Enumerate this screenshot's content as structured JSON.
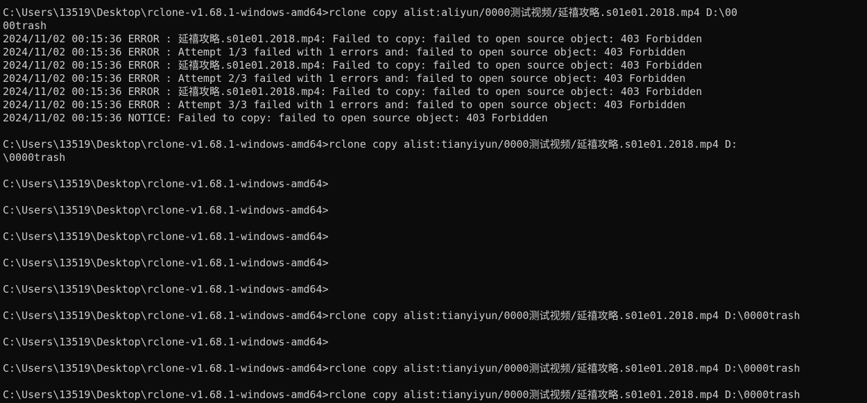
{
  "terminal": {
    "lines": [
      "C:\\Users\\13519\\Desktop\\rclone-v1.68.1-windows-amd64>rclone copy alist:aliyun/0000测试视频/延禧攻略.s01e01.2018.mp4 D:\\00",
      "00trash",
      "2024/11/02 00:15:36 ERROR : 延禧攻略.s01e01.2018.mp4: Failed to copy: failed to open source object: 403 Forbidden",
      "2024/11/02 00:15:36 ERROR : Attempt 1/3 failed with 1 errors and: failed to open source object: 403 Forbidden",
      "2024/11/02 00:15:36 ERROR : 延禧攻略.s01e01.2018.mp4: Failed to copy: failed to open source object: 403 Forbidden",
      "2024/11/02 00:15:36 ERROR : Attempt 2/3 failed with 1 errors and: failed to open source object: 403 Forbidden",
      "2024/11/02 00:15:36 ERROR : 延禧攻略.s01e01.2018.mp4: Failed to copy: failed to open source object: 403 Forbidden",
      "2024/11/02 00:15:36 ERROR : Attempt 3/3 failed with 1 errors and: failed to open source object: 403 Forbidden",
      "2024/11/02 00:15:36 NOTICE: Failed to copy: failed to open source object: 403 Forbidden",
      "",
      "C:\\Users\\13519\\Desktop\\rclone-v1.68.1-windows-amd64>rclone copy alist:tianyiyun/0000测试视频/延禧攻略.s01e01.2018.mp4 D:",
      "\\0000trash",
      "",
      "C:\\Users\\13519\\Desktop\\rclone-v1.68.1-windows-amd64>",
      "",
      "C:\\Users\\13519\\Desktop\\rclone-v1.68.1-windows-amd64>",
      "",
      "C:\\Users\\13519\\Desktop\\rclone-v1.68.1-windows-amd64>",
      "",
      "C:\\Users\\13519\\Desktop\\rclone-v1.68.1-windows-amd64>",
      "",
      "C:\\Users\\13519\\Desktop\\rclone-v1.68.1-windows-amd64>",
      "",
      "C:\\Users\\13519\\Desktop\\rclone-v1.68.1-windows-amd64>rclone copy alist:tianyiyun/0000测试视频/延禧攻略.s01e01.2018.mp4 D:\\0000trash",
      "",
      "C:\\Users\\13519\\Desktop\\rclone-v1.68.1-windows-amd64>",
      "",
      "C:\\Users\\13519\\Desktop\\rclone-v1.68.1-windows-amd64>rclone copy alist:tianyiyun/0000测试视频/延禧攻略.s01e01.2018.mp4 D:\\0000trash",
      "",
      "C:\\Users\\13519\\Desktop\\rclone-v1.68.1-windows-amd64>rclone copy alist:tianyiyun/0000测试视频/延禧攻略.s01e01.2018.mp4 D:\\0000trash"
    ]
  }
}
